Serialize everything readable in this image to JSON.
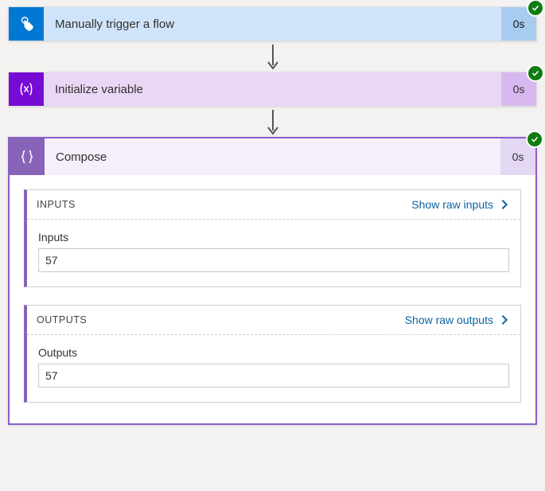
{
  "trigger": {
    "title": "Manually trigger a flow",
    "duration": "0s",
    "status": "succeeded",
    "icon": "touch-icon"
  },
  "variable": {
    "title": "Initialize variable",
    "duration": "0s",
    "status": "succeeded",
    "icon": "variable-fx-icon"
  },
  "compose": {
    "title": "Compose",
    "duration": "0s",
    "status": "succeeded",
    "icon": "compose-braces-icon",
    "inputs": {
      "section_title": "INPUTS",
      "link_label": "Show raw inputs",
      "field_label": "Inputs",
      "field_value": "57"
    },
    "outputs": {
      "section_title": "OUTPUTS",
      "link_label": "Show raw outputs",
      "field_label": "Outputs",
      "field_value": "57"
    }
  }
}
